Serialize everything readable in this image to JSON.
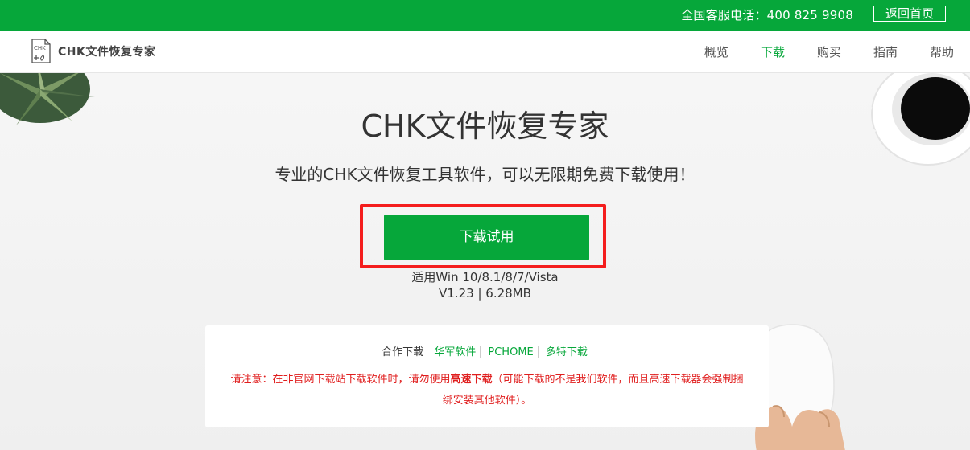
{
  "topbar": {
    "hotline": "全国客服电话：400 825 9908",
    "home_button": "返回首页"
  },
  "logo": {
    "icon_text": "CHK",
    "name": "CHK文件恢复专家"
  },
  "nav": {
    "items": [
      {
        "label": "概览"
      },
      {
        "label": "下载"
      },
      {
        "label": "购买"
      },
      {
        "label": "指南"
      },
      {
        "label": "帮助"
      }
    ],
    "active": "下载"
  },
  "hero": {
    "title": "CHK文件恢复专家",
    "subtitle": "专业的CHK文件恢复工具软件，可以无限期免费下载使用！",
    "download_button": "下载试用",
    "compatibility": "适用Win 10/8.1/8/7/Vista",
    "version": "V1.23 | 6.28MB"
  },
  "partners": {
    "label": "合作下载",
    "links": [
      "华军软件",
      "PCHOME",
      "多特下载"
    ]
  },
  "notice": {
    "prefix": "请注意：在非官网下载站下载软件时，请勿使用",
    "emphasis": "高速下载",
    "suffix": "（可能下载的不是我们软件，而且高速下载器会强制捆绑安装其他软件）。"
  },
  "colors": {
    "brand_green": "#06a73a",
    "highlight_red": "#f41d1d",
    "warning_red": "#e01e1e"
  }
}
